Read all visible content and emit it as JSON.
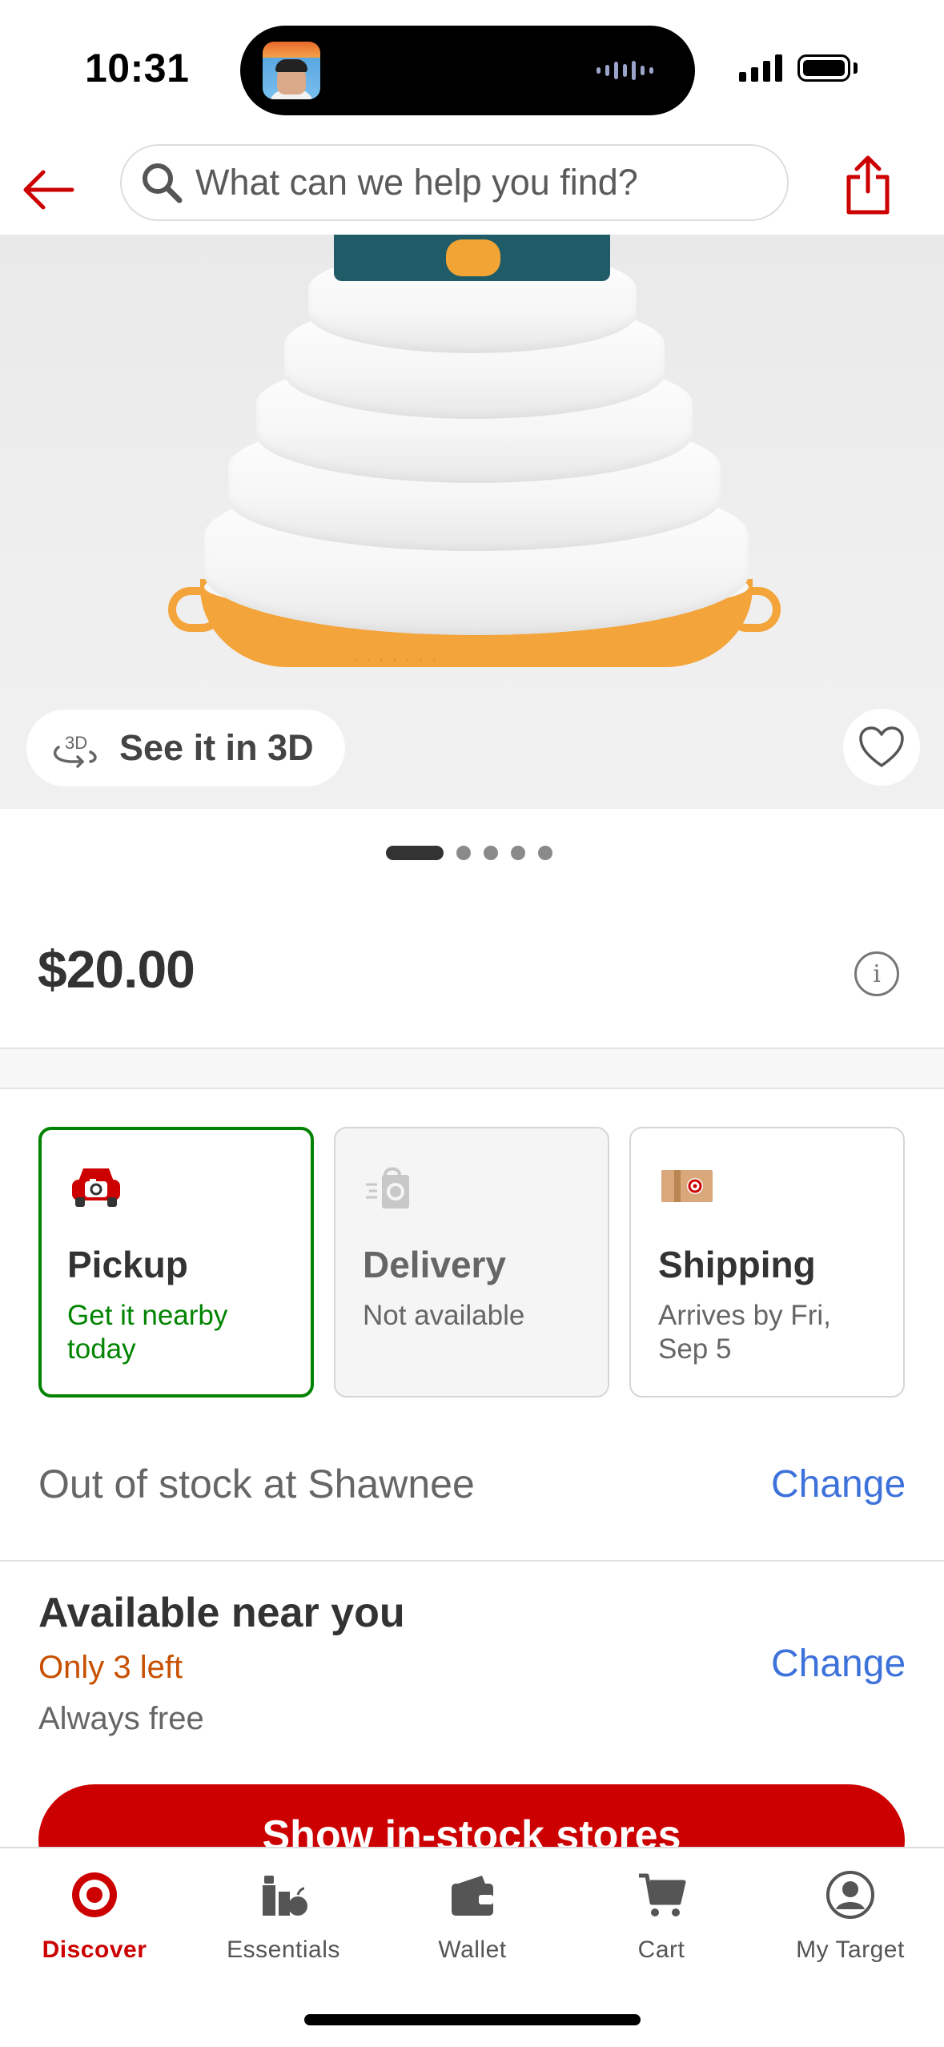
{
  "status": {
    "time": "10:31"
  },
  "search": {
    "placeholder": "What can we help you find?"
  },
  "gallery": {
    "view_3d_label": "See it in 3D",
    "image_count": 5,
    "active_index": 0
  },
  "product": {
    "price": "$20.00"
  },
  "fulfillment": [
    {
      "title": "Pickup",
      "subtitle": "Get it nearby today",
      "state": "selected",
      "icon": "car-pickup-icon"
    },
    {
      "title": "Delivery",
      "subtitle": "Not available",
      "state": "disabled",
      "icon": "delivery-bag-icon"
    },
    {
      "title": "Shipping",
      "subtitle": "Arrives by Fri, Sep 5",
      "state": "default",
      "icon": "shipping-box-icon"
    }
  ],
  "store": {
    "out_of_stock": "Out of stock at Shawnee",
    "change_label": "Change"
  },
  "availability": {
    "title": "Available near you",
    "stock": "Only 3 left",
    "cost": "Always free",
    "change_label": "Change",
    "button_label": "Show in-stock stores"
  },
  "tabs": [
    {
      "label": "Discover",
      "icon": "target-logo-icon",
      "active": true
    },
    {
      "label": "Essentials",
      "icon": "essentials-icon",
      "active": false
    },
    {
      "label": "Wallet",
      "icon": "wallet-icon",
      "active": false
    },
    {
      "label": "Cart",
      "icon": "cart-icon",
      "active": false
    },
    {
      "label": "My Target",
      "icon": "account-icon",
      "active": false
    }
  ],
  "colors": {
    "brand_red": "#cc0000",
    "selected_green": "#008300",
    "link_blue": "#3e72db",
    "stock_orange": "#c75000"
  }
}
